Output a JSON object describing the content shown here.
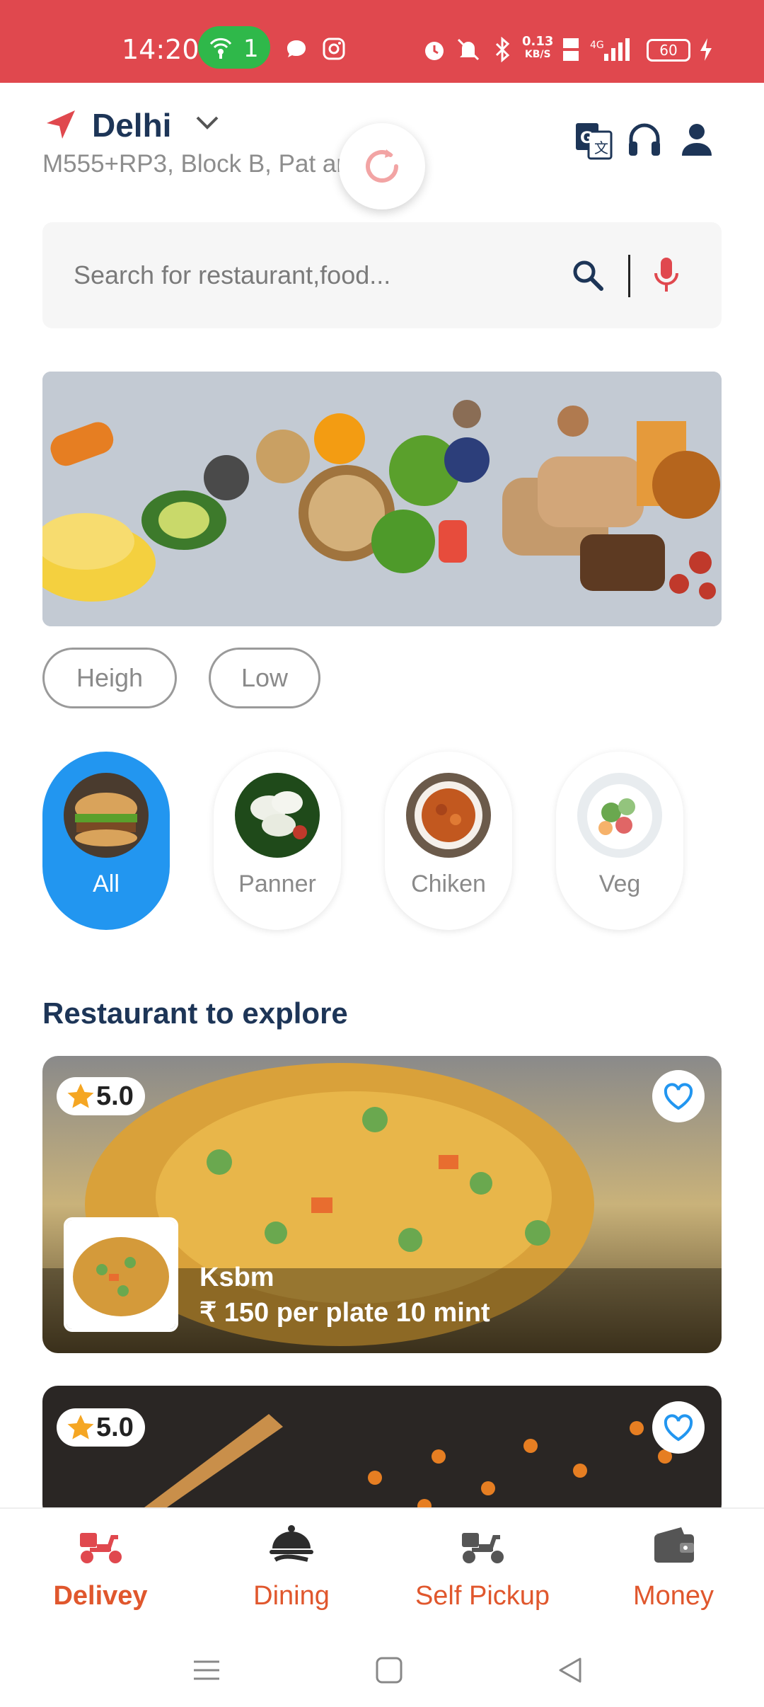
{
  "status_bar": {
    "time": "14:20",
    "hotspot_count": "1",
    "speed_value": "0.13",
    "speed_unit": "KB/S",
    "battery": "60",
    "icons": [
      "hotspot-icon",
      "chat-icon",
      "instagram-icon",
      "alarm-icon",
      "mute-icon",
      "bluetooth-icon",
      "volte-icon",
      "signal-4g-icon",
      "battery-icon",
      "charging-icon"
    ]
  },
  "header": {
    "city": "Delhi",
    "address": "M555+RP3, Block B, Pat        ar, De...",
    "icons": [
      "location-arrow-icon",
      "chevron-down-icon",
      "translate-icon",
      "headset-icon",
      "profile-icon",
      "refresh-icon"
    ]
  },
  "search": {
    "placeholder": "Search for restaurant,food..."
  },
  "sort_chips": [
    "Heigh",
    "Low"
  ],
  "categories": [
    {
      "label": "All",
      "active": true
    },
    {
      "label": "Panner",
      "active": false
    },
    {
      "label": "Chiken",
      "active": false
    },
    {
      "label": "Veg",
      "active": false
    }
  ],
  "section_title": "Restaurant to explore",
  "restaurants": [
    {
      "rating": "5.0",
      "name": "Ksbm",
      "meta": "₹ 150 per plate 10 mint"
    },
    {
      "rating": "5.0",
      "name": "",
      "meta": ""
    }
  ],
  "bottom_nav": [
    {
      "label": "Delivey",
      "icon": "scooter-icon",
      "active": true
    },
    {
      "label": "Dining",
      "icon": "cloche-icon",
      "active": false
    },
    {
      "label": "Self Pickup",
      "icon": "pickup-scooter-icon",
      "active": false
    },
    {
      "label": "Money",
      "icon": "wallet-icon",
      "active": false
    }
  ],
  "colors": {
    "status_bar": "#e0484e",
    "brand_orange": "#e0572d",
    "active_category": "#2296f0",
    "title_navy": "#1d3557"
  }
}
